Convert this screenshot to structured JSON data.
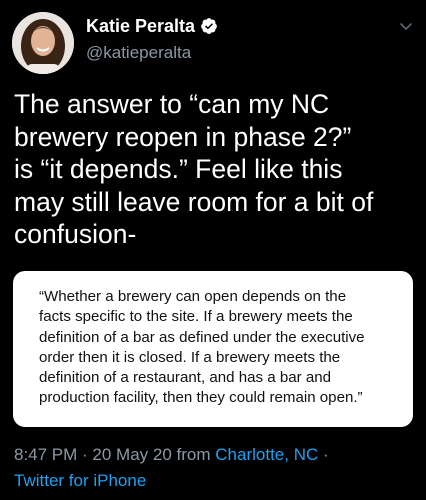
{
  "author": {
    "display_name": "Katie Peralta",
    "handle": "@katieperalta",
    "verified": true
  },
  "tweet": {
    "text_lines": [
      "The answer to “can my NC",
      "brewery reopen in phase 2?”",
      "is “it depends.” Feel like this",
      "may still leave room for a bit of",
      "confusion-"
    ]
  },
  "quote": {
    "lines": [
      "“Whether a brewery can open depends on the",
      "facts specific to the site. If a brewery meets the",
      "definition of a bar as defined under the executive",
      "order then it is closed. If a brewery meets the",
      "definition of a restaurant, and has a bar and",
      "production facility, then they could remain open.”"
    ]
  },
  "meta": {
    "time": "8:47 PM",
    "separator": " · ",
    "date": "20 May 20",
    "from_label": " from ",
    "location": "Charlotte, NC",
    "trailing_separator": " ·",
    "source": "Twitter for iPhone"
  },
  "icons": {
    "verified": "verified-badge-icon",
    "menu": "chevron-down-icon"
  },
  "colors": {
    "background": "#000000",
    "text": "#ffffff",
    "secondary_text": "#8b98a5",
    "link": "#1da1f2",
    "card": "#ffffff"
  }
}
